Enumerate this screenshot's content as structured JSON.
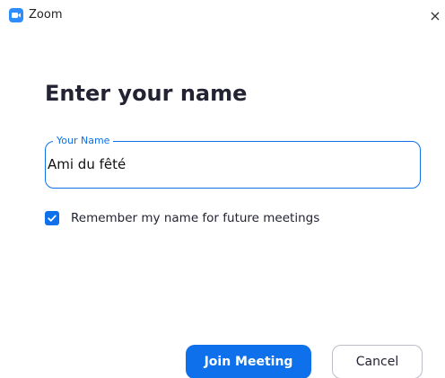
{
  "window": {
    "title": "Zoom",
    "app_icon": "zoom-camera-icon",
    "close_glyph": "×"
  },
  "heading": "Enter your name",
  "name_field": {
    "label": "Your Name",
    "value": "Ami du fêté",
    "focused": true
  },
  "remember_checkbox": {
    "label": "Remember my name for future meetings",
    "checked": true
  },
  "buttons": {
    "join_label": "Join Meeting",
    "cancel_label": "Cancel"
  },
  "colors": {
    "accent": "#0E71EB",
    "app_icon": "#2D8CFF",
    "text": "#232333"
  }
}
